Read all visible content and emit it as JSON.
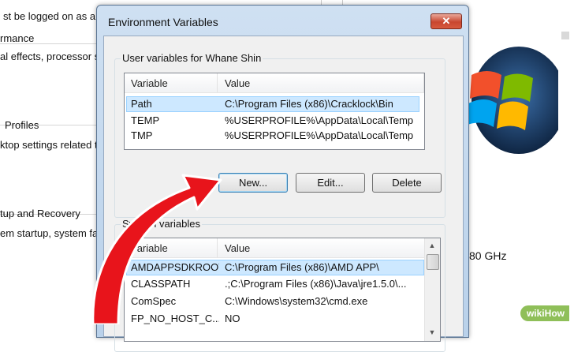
{
  "background": {
    "lines": [
      "st be logged on as a",
      "rmance",
      "al effects, processor sc",
      "Profiles",
      "ktop settings related to",
      "tup and Recovery",
      "em startup, system failu"
    ],
    "right_text": "80 GHz"
  },
  "dialog": {
    "title": "Environment Variables",
    "close_label": "✕"
  },
  "user_vars": {
    "label": "User variables for Whane Shin",
    "headers": [
      "Variable",
      "Value"
    ],
    "rows": [
      {
        "variable": "Path",
        "value": "C:\\Program Files (x86)\\Cracklock\\Bin"
      },
      {
        "variable": "TEMP",
        "value": "%USERPROFILE%\\AppData\\Local\\Temp"
      },
      {
        "variable": "TMP",
        "value": "%USERPROFILE%\\AppData\\Local\\Temp"
      }
    ],
    "buttons": {
      "new": "New...",
      "edit": "Edit...",
      "delete": "Delete"
    }
  },
  "system_vars": {
    "label": "System variables",
    "headers": [
      "Variable",
      "Value"
    ],
    "rows": [
      {
        "variable": "AMDAPPSDKROOT",
        "value": "C:\\Program Files (x86)\\AMD APP\\"
      },
      {
        "variable": "CLASSPATH",
        "value": ".;C:\\Program Files (x86)\\Java\\jre1.5.0\\..."
      },
      {
        "variable": "ComSpec",
        "value": "C:\\Windows\\system32\\cmd.exe"
      },
      {
        "variable": "FP_NO_HOST_C...",
        "value": "NO"
      }
    ]
  },
  "watermark": {
    "prefix": "wiki",
    "suffix": "How"
  },
  "colors": {
    "selection": "#cde8ff",
    "arrow": "#e8141b",
    "title_bg": "#b9d1ea"
  }
}
